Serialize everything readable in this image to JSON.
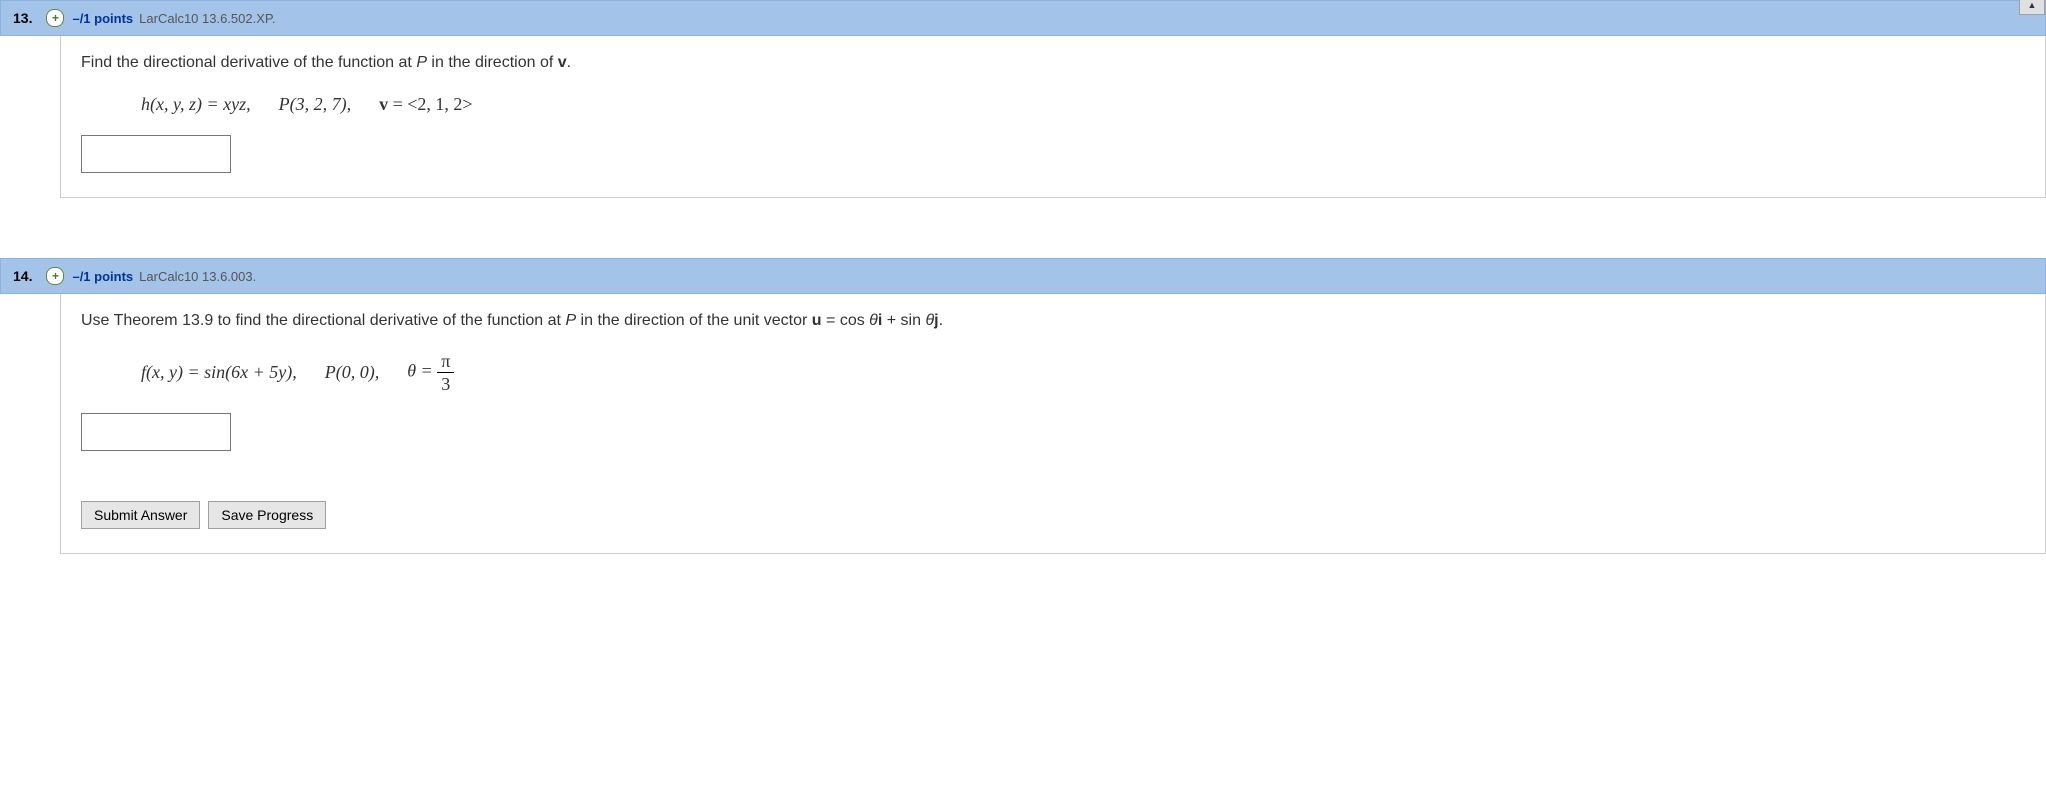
{
  "questions": [
    {
      "number": "13.",
      "expander": "+",
      "points": "–/1 points",
      "source": "LarCalc10 13.6.502.XP.",
      "prompt_before_P": "Find the directional derivative of the function at ",
      "prompt_P": "P",
      "prompt_mid": " in the direction of ",
      "prompt_v": "v",
      "prompt_after": ".",
      "math": {
        "func": "h(x, y, z) = xyz,",
        "point": "P(3, 2, 7),",
        "vec_label": "v",
        "vec_value": " = <2, 1, 2>"
      },
      "has_scroll_tab": true
    },
    {
      "number": "14.",
      "expander": "+",
      "points": "–/1 points",
      "source": "LarCalc10 13.6.003.",
      "prompt_before_P": "Use Theorem 13.9 to find the directional derivative of the function at ",
      "prompt_P": "P",
      "prompt_mid": " in the direction of the unit vector  ",
      "prompt_u": "u",
      "prompt_eq": " = cos ",
      "theta1": "θ",
      "unit_i": "i",
      "plus": " + sin ",
      "theta2": "θ",
      "unit_j": "j",
      "prompt_after": ".",
      "math": {
        "func": "f(x, y) = sin(6x + 5y),",
        "point": "P(0, 0),",
        "theta_label": "θ = ",
        "frac_num": "π",
        "frac_den": "3"
      },
      "has_buttons": true
    }
  ],
  "buttons": {
    "submit": "Submit Answer",
    "save": "Save Progress"
  }
}
